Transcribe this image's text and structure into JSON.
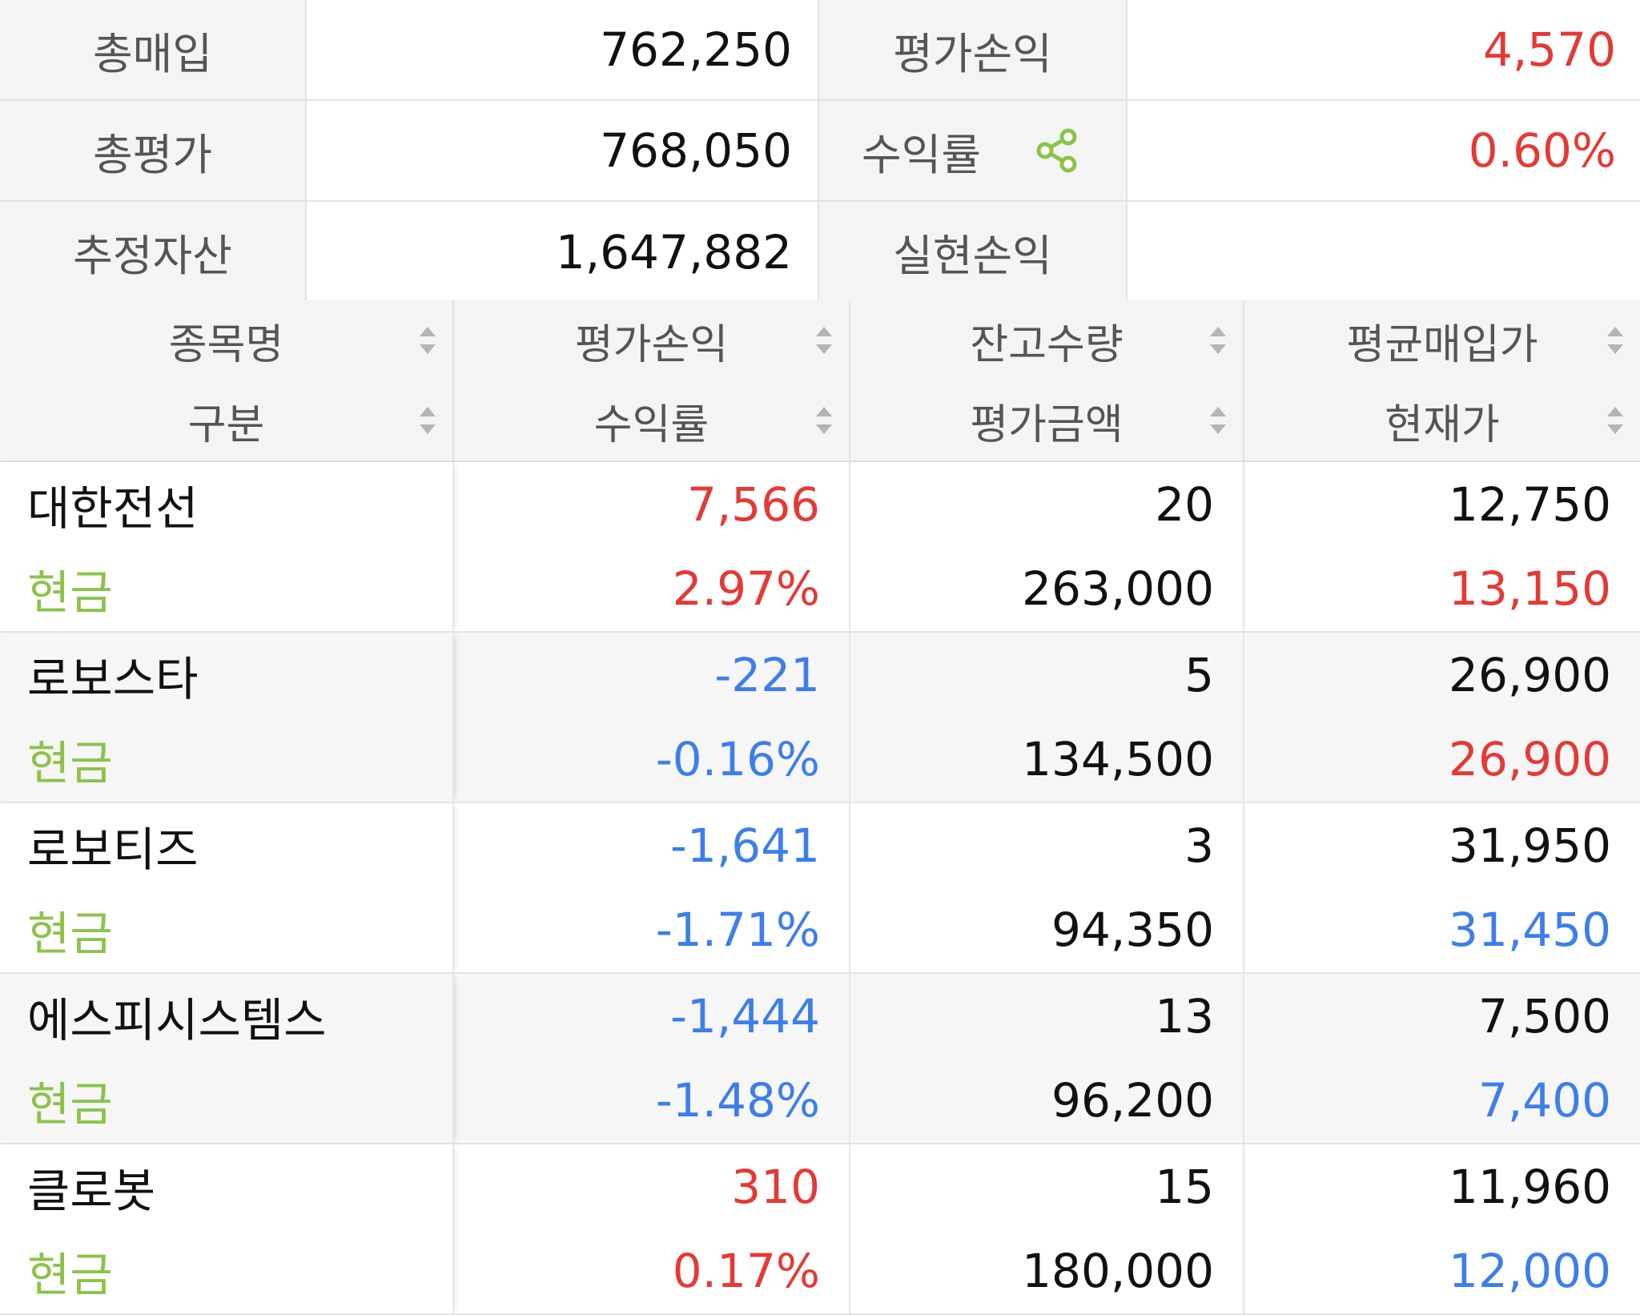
{
  "summary": {
    "rows": [
      {
        "label1": "총매입",
        "value1": "762,250",
        "label2": "평가손익",
        "value2": "4,570",
        "value2_color": "red"
      },
      {
        "label1": "총평가",
        "value1": "768,050",
        "label2": "수익률",
        "value2": "0.60%",
        "value2_color": "red",
        "share_icon": "share-icon"
      },
      {
        "label1": "추정자산",
        "value1": "1,647,882",
        "label2": "실현손익",
        "value2": "",
        "value2_color": "black"
      }
    ]
  },
  "table": {
    "headers": [
      {
        "top": "종목명",
        "bottom": "구분"
      },
      {
        "top": "평가손익",
        "bottom": "수익률"
      },
      {
        "top": "잔고수량",
        "bottom": "평가금액"
      },
      {
        "top": "평균매입가",
        "bottom": "현재가"
      }
    ],
    "rows": [
      {
        "name": "대한전선",
        "type": "현금",
        "pnl": "7,566",
        "pnl_color": "red",
        "rate": "2.97%",
        "rate_color": "red",
        "qty": "20",
        "eval": "263,000",
        "avg_price": "12,750",
        "cur_price": "13,150",
        "cur_color": "red"
      },
      {
        "name": "로보스타",
        "type": "현금",
        "pnl": "-221",
        "pnl_color": "blue",
        "rate": "-0.16%",
        "rate_color": "blue",
        "qty": "5",
        "eval": "134,500",
        "avg_price": "26,900",
        "cur_price": "26,900",
        "cur_color": "red"
      },
      {
        "name": "로보티즈",
        "type": "현금",
        "pnl": "-1,641",
        "pnl_color": "blue",
        "rate": "-1.71%",
        "rate_color": "blue",
        "qty": "3",
        "eval": "94,350",
        "avg_price": "31,950",
        "cur_price": "31,450",
        "cur_color": "blue"
      },
      {
        "name": "에스피시스템스",
        "type": "현금",
        "pnl": "-1,444",
        "pnl_color": "blue",
        "rate": "-1.48%",
        "rate_color": "blue",
        "qty": "13",
        "eval": "96,200",
        "avg_price": "7,500",
        "cur_price": "7,400",
        "cur_color": "blue"
      },
      {
        "name": "클로봇",
        "type": "현금",
        "pnl": "310",
        "pnl_color": "red",
        "rate": "0.17%",
        "rate_color": "red",
        "qty": "15",
        "eval": "180,000",
        "avg_price": "11,960",
        "cur_price": "12,000",
        "cur_color": "blue"
      }
    ]
  },
  "colors": {
    "red": "#e53935",
    "blue": "#3d7eea",
    "green": "#8bc34a",
    "label_bg": "#f4f4f4",
    "border": "#e2e2e2"
  }
}
